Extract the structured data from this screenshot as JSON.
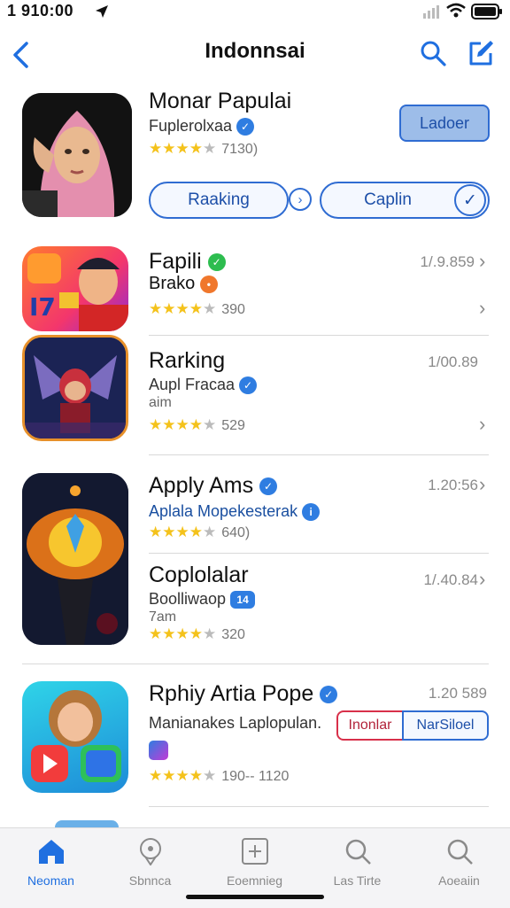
{
  "status": {
    "time": "1 910:00"
  },
  "nav": {
    "title": "Indonnsai"
  },
  "featured": {
    "title": "Monar Papulai",
    "subtitle": "Fuplerolxaa",
    "rating_count": "7130)",
    "stars": 4,
    "top_button": "Ladoer",
    "button_left": "Raaking",
    "button_right": "Caplin"
  },
  "apps": [
    {
      "title": "Fapili",
      "subtitle": "Brako",
      "rating_count": "390",
      "price": "1/.9.859",
      "stars": 4
    },
    {
      "title": "Rarking",
      "subtitle": "Aupl Fracaa",
      "extra": "aim",
      "rating_count": "529",
      "price": "1/00.89",
      "stars": 4
    },
    {
      "title": "Apply Ams",
      "subtitle": "Aplala Mopekesterak",
      "rating_count": "640)",
      "price": "1.20:56",
      "stars": 4
    },
    {
      "title": "Coplolalar",
      "subtitle": "Boolliwaop",
      "extra": "7am",
      "rating_count": "320",
      "price": "1/.40.84",
      "stars": 4
    },
    {
      "title": "Rphiy Artia Pope",
      "subtitle": "Manianakes Laplopulan.",
      "rating_count": "190-- 1120",
      "price": "1.20 589",
      "stars": 4,
      "button_left": "Inonlar",
      "button_right": "NarSiloel"
    }
  ],
  "tabs": [
    {
      "label": "Neoman",
      "icon": "home-icon",
      "active": true
    },
    {
      "label": "Sbnnca",
      "icon": "pin-icon",
      "active": false
    },
    {
      "label": "Eoemnieg",
      "icon": "plus-square-icon",
      "active": false
    },
    {
      "label": "Las Tirte",
      "icon": "search-icon",
      "active": false
    },
    {
      "label": "Aoeaiin",
      "icon": "search-icon",
      "active": false
    }
  ],
  "colors": {
    "accent": "#1f6fe0",
    "star": "#f4c21b",
    "divider": "#d9d9d9"
  }
}
